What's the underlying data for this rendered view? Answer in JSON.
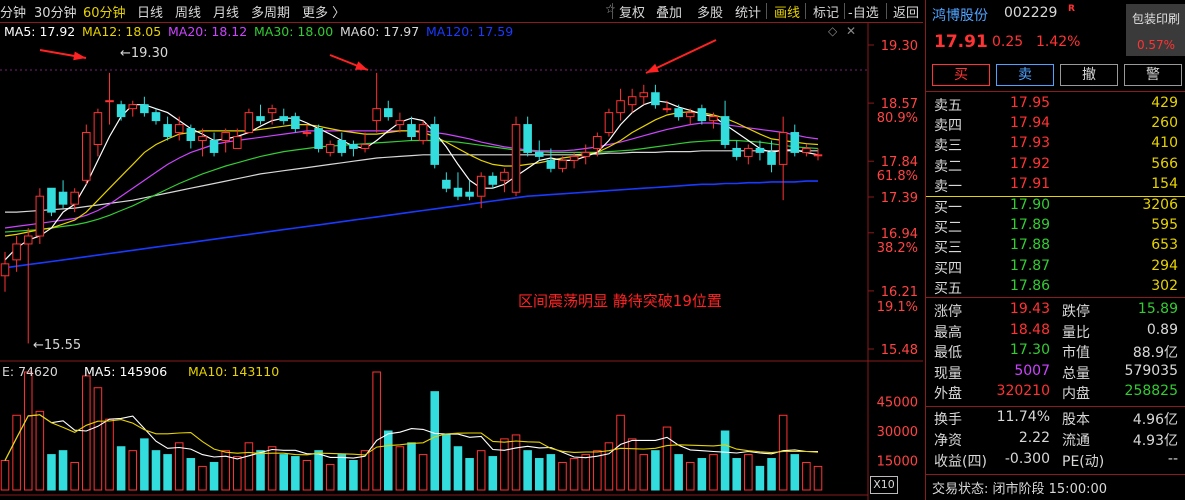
{
  "toolbar": {
    "periods": [
      "分钟",
      "30分钟",
      "60分钟",
      "日线",
      "周线",
      "月线",
      "多周期",
      "更多 〉"
    ],
    "active_period": "60分钟",
    "right_buttons": [
      "复权",
      "叠加",
      "多股",
      "统计",
      "画线",
      "标记",
      "-自选",
      "返回"
    ]
  },
  "ma_legend": {
    "ma5": "MA5: 17.92",
    "ma12": "MA12: 18.05",
    "ma20": "MA20: 18.12",
    "ma30": "MA30: 18.00",
    "ma60": "MA60: 17.97",
    "ma120": "MA120: 17.59"
  },
  "annotations": {
    "high_label": "19.30",
    "low_label": "15.55",
    "note": "区间震荡明显  静待突破19位置"
  },
  "volume_legend": {
    "vol": "E: 74620",
    "ma5": "MA5: 145906",
    "ma10": "MA10: 143110"
  },
  "zoom_label": "X10",
  "colors": {
    "up": "#ff3333",
    "down": "#33dddd",
    "ma5": "#ffffff",
    "ma12": "#e6d200",
    "ma20": "#cc44ff",
    "ma30": "#33cc33",
    "ma60": "#d8d8d8",
    "ma120": "#1a3aff"
  },
  "chart_data": {
    "type": "candlestick",
    "price_axis": {
      "ticks": [
        "19.30",
        "18.57",
        "17.84",
        "17.39",
        "16.94",
        "16.21",
        "15.48"
      ],
      "pct_ticks": [
        "80.9%",
        "61.8%",
        "38.2%",
        "19.1%"
      ]
    },
    "volume_axis": {
      "ticks": [
        "45000",
        "30000",
        "15000"
      ]
    },
    "candles": [
      [
        16.4,
        16.7,
        16.2,
        16.55
      ],
      [
        16.6,
        16.9,
        16.45,
        16.8
      ],
      [
        16.8,
        17.0,
        15.55,
        16.9
      ],
      [
        16.9,
        17.5,
        16.8,
        17.4
      ],
      [
        17.5,
        17.5,
        17.15,
        17.2
      ],
      [
        17.45,
        17.6,
        17.25,
        17.3
      ],
      [
        17.3,
        17.5,
        17.2,
        17.45
      ],
      [
        17.6,
        18.3,
        17.55,
        18.2
      ],
      [
        18.05,
        18.5,
        17.9,
        18.45
      ],
      [
        18.6,
        18.95,
        18.3,
        18.6
      ],
      [
        18.55,
        18.6,
        18.35,
        18.4
      ],
      [
        18.5,
        18.6,
        18.4,
        18.55
      ],
      [
        18.55,
        18.65,
        18.4,
        18.45
      ],
      [
        18.45,
        18.5,
        18.3,
        18.35
      ],
      [
        18.3,
        18.4,
        18.1,
        18.15
      ],
      [
        18.2,
        18.4,
        18.1,
        18.3
      ],
      [
        18.25,
        18.3,
        18.0,
        18.1
      ],
      [
        18.1,
        18.25,
        17.9,
        18.15
      ],
      [
        18.1,
        18.2,
        17.9,
        17.95
      ],
      [
        18.1,
        18.25,
        17.95,
        18.2
      ],
      [
        18.0,
        18.25,
        18.0,
        18.15
      ],
      [
        18.2,
        18.5,
        18.2,
        18.45
      ],
      [
        18.4,
        18.55,
        18.3,
        18.35
      ],
      [
        18.45,
        18.55,
        18.3,
        18.5
      ],
      [
        18.4,
        18.5,
        18.3,
        18.35
      ],
      [
        18.4,
        18.45,
        18.2,
        18.25
      ],
      [
        18.2,
        18.3,
        18.15,
        18.2
      ],
      [
        18.25,
        18.3,
        17.95,
        18.0
      ],
      [
        17.95,
        18.1,
        17.9,
        18.05
      ],
      [
        18.1,
        18.2,
        17.9,
        17.95
      ],
      [
        18.05,
        18.1,
        17.9,
        18.0
      ],
      [
        18.0,
        18.2,
        17.95,
        18.05
      ],
      [
        18.35,
        18.95,
        18.2,
        18.5
      ],
      [
        18.5,
        18.6,
        18.35,
        18.4
      ],
      [
        18.3,
        18.45,
        18.2,
        18.35
      ],
      [
        18.3,
        18.4,
        18.1,
        18.15
      ],
      [
        18.1,
        18.35,
        18.05,
        18.3
      ],
      [
        18.3,
        18.4,
        17.75,
        17.8
      ],
      [
        17.6,
        17.7,
        17.45,
        17.5
      ],
      [
        17.5,
        17.7,
        17.35,
        17.4
      ],
      [
        17.45,
        17.6,
        17.35,
        17.4
      ],
      [
        17.4,
        17.7,
        17.25,
        17.65
      ],
      [
        17.65,
        17.7,
        17.5,
        17.55
      ],
      [
        17.6,
        17.75,
        17.45,
        17.7
      ],
      [
        17.45,
        18.4,
        17.4,
        18.3
      ],
      [
        18.3,
        18.4,
        17.9,
        17.95
      ],
      [
        17.95,
        18.1,
        17.85,
        17.9
      ],
      [
        17.85,
        18.0,
        17.7,
        17.75
      ],
      [
        17.75,
        17.9,
        17.7,
        17.85
      ],
      [
        17.85,
        17.95,
        17.75,
        17.9
      ],
      [
        17.9,
        18.05,
        17.8,
        17.95
      ],
      [
        18.0,
        18.2,
        17.9,
        18.15
      ],
      [
        18.2,
        18.5,
        18.15,
        18.45
      ],
      [
        18.45,
        18.75,
        18.35,
        18.6
      ],
      [
        18.55,
        18.75,
        18.45,
        18.65
      ],
      [
        18.65,
        18.8,
        18.55,
        18.7
      ],
      [
        18.7,
        18.8,
        18.5,
        18.55
      ],
      [
        18.5,
        18.6,
        18.45,
        18.5
      ],
      [
        18.5,
        18.55,
        18.35,
        18.4
      ],
      [
        18.4,
        18.5,
        18.3,
        18.45
      ],
      [
        18.5,
        18.55,
        18.3,
        18.35
      ],
      [
        18.35,
        18.45,
        18.25,
        18.4
      ],
      [
        18.4,
        18.6,
        18.0,
        18.05
      ],
      [
        18.0,
        18.1,
        17.85,
        17.9
      ],
      [
        17.9,
        18.05,
        17.8,
        18.0
      ],
      [
        18.0,
        18.1,
        17.85,
        17.95
      ],
      [
        17.95,
        18.1,
        17.7,
        17.8
      ],
      [
        17.8,
        18.4,
        17.35,
        18.2
      ],
      [
        18.2,
        18.3,
        17.9,
        17.95
      ],
      [
        17.95,
        18.05,
        17.9,
        18.0
      ],
      [
        17.92,
        18.0,
        17.85,
        17.92
      ]
    ],
    "volumes": [
      15000,
      38000,
      60000,
      40000,
      18000,
      20000,
      14000,
      58000,
      52000,
      36000,
      22000,
      20000,
      26000,
      20000,
      18000,
      24000,
      16000,
      12000,
      14000,
      20000,
      17000,
      24000,
      20000,
      22000,
      18000,
      17000,
      15000,
      20000,
      13000,
      18000,
      15000,
      20000,
      60000,
      30000,
      22000,
      24000,
      18000,
      50000,
      28000,
      22000,
      16000,
      20000,
      17000,
      26000,
      28000,
      20000,
      16000,
      18000,
      14000,
      16000,
      18000,
      20000,
      24000,
      38000,
      26000,
      18000,
      20000,
      32000,
      18000,
      14000,
      16000,
      18000,
      30000,
      16000,
      18000,
      12000,
      16000,
      38000,
      18000,
      14000,
      12000
    ],
    "ma_lines": {
      "ma5": [
        16.6,
        16.75,
        16.85,
        16.9,
        17.0,
        17.2,
        17.3,
        17.55,
        17.85,
        18.15,
        18.4,
        18.55,
        18.55,
        18.5,
        18.45,
        18.35,
        18.25,
        18.18,
        18.1,
        18.12,
        18.15,
        18.2,
        18.28,
        18.35,
        18.38,
        18.38,
        18.32,
        18.25,
        18.18,
        18.1,
        18.03,
        18.0,
        18.1,
        18.22,
        18.33,
        18.38,
        18.35,
        18.2,
        18.02,
        17.8,
        17.6,
        17.5,
        17.5,
        17.55,
        17.65,
        17.75,
        17.85,
        17.88,
        17.85,
        17.85,
        17.9,
        17.95,
        18.1,
        18.3,
        18.45,
        18.55,
        18.6,
        18.58,
        18.52,
        18.48,
        18.43,
        18.4,
        18.3,
        18.2,
        18.1,
        18.0,
        17.95,
        17.98,
        17.98,
        17.95,
        17.92
      ],
      "ma12": [
        16.9,
        16.92,
        16.95,
        16.98,
        17.0,
        17.05,
        17.1,
        17.2,
        17.35,
        17.5,
        17.65,
        17.8,
        17.95,
        18.05,
        18.12,
        18.18,
        18.2,
        18.22,
        18.22,
        18.22,
        18.22,
        18.22,
        18.24,
        18.26,
        18.28,
        18.3,
        18.3,
        18.28,
        18.25,
        18.22,
        18.2,
        18.18,
        18.18,
        18.2,
        18.22,
        18.22,
        18.2,
        18.15,
        18.08,
        18.0,
        17.92,
        17.85,
        17.8,
        17.78,
        17.78,
        17.8,
        17.82,
        17.85,
        17.88,
        17.9,
        17.92,
        17.95,
        18.02,
        18.1,
        18.2,
        18.28,
        18.36,
        18.42,
        18.45,
        18.46,
        18.45,
        18.42,
        18.38,
        18.32,
        18.25,
        18.18,
        18.12,
        18.1,
        18.08,
        18.06,
        18.05
      ],
      "ma20": [
        17.0,
        17.02,
        17.04,
        17.06,
        17.08,
        17.1,
        17.12,
        17.16,
        17.22,
        17.3,
        17.4,
        17.5,
        17.6,
        17.7,
        17.8,
        17.88,
        17.95,
        18.0,
        18.05,
        18.08,
        18.1,
        18.12,
        18.14,
        18.16,
        18.18,
        18.2,
        18.22,
        18.22,
        18.22,
        18.22,
        18.22,
        18.22,
        18.22,
        18.22,
        18.22,
        18.22,
        18.22,
        18.2,
        18.18,
        18.15,
        18.12,
        18.08,
        18.05,
        18.02,
        18.0,
        17.98,
        17.97,
        17.97,
        17.97,
        17.98,
        18.0,
        18.02,
        18.05,
        18.08,
        18.12,
        18.16,
        18.2,
        18.24,
        18.27,
        18.3,
        18.32,
        18.32,
        18.3,
        18.28,
        18.26,
        18.24,
        18.22,
        18.2,
        18.17,
        18.14,
        18.12
      ],
      "ma30": [
        16.95,
        16.96,
        16.97,
        16.98,
        17.0,
        17.02,
        17.04,
        17.07,
        17.11,
        17.16,
        17.22,
        17.28,
        17.35,
        17.42,
        17.49,
        17.56,
        17.62,
        17.68,
        17.73,
        17.78,
        17.82,
        17.86,
        17.9,
        17.93,
        17.96,
        17.98,
        18.0,
        18.02,
        18.03,
        18.04,
        18.05,
        18.06,
        18.07,
        18.08,
        18.09,
        18.1,
        18.1,
        18.1,
        18.09,
        18.08,
        18.06,
        18.04,
        18.02,
        18.0,
        17.98,
        17.97,
        17.96,
        17.95,
        17.95,
        17.95,
        17.95,
        17.95,
        17.96,
        17.97,
        17.98,
        18.0,
        18.02,
        18.04,
        18.06,
        18.08,
        18.09,
        18.1,
        18.1,
        18.1,
        18.09,
        18.08,
        18.06,
        18.04,
        18.02,
        18.01,
        18.0
      ],
      "ma60": [
        17.2,
        17.2,
        17.21,
        17.22,
        17.23,
        17.24,
        17.25,
        17.27,
        17.29,
        17.31,
        17.33,
        17.35,
        17.38,
        17.41,
        17.44,
        17.47,
        17.5,
        17.53,
        17.56,
        17.59,
        17.62,
        17.65,
        17.68,
        17.7,
        17.72,
        17.74,
        17.76,
        17.78,
        17.8,
        17.82,
        17.84,
        17.86,
        17.88,
        17.89,
        17.9,
        17.91,
        17.92,
        17.92,
        17.92,
        17.92,
        17.92,
        17.92,
        17.92,
        17.92,
        17.92,
        17.92,
        17.92,
        17.92,
        17.92,
        17.92,
        17.93,
        17.93,
        17.94,
        17.94,
        17.95,
        17.95,
        17.95,
        17.96,
        17.96,
        17.96,
        17.97,
        17.97,
        17.97,
        17.97,
        17.97,
        17.97,
        17.97,
        17.97,
        17.97,
        17.97,
        17.97
      ],
      "ma120": [
        16.5,
        16.52,
        16.54,
        16.56,
        16.58,
        16.6,
        16.62,
        16.64,
        16.66,
        16.68,
        16.7,
        16.72,
        16.74,
        16.76,
        16.78,
        16.8,
        16.82,
        16.84,
        16.86,
        16.88,
        16.9,
        16.92,
        16.94,
        16.96,
        16.98,
        17.0,
        17.02,
        17.04,
        17.06,
        17.08,
        17.1,
        17.12,
        17.14,
        17.16,
        17.18,
        17.2,
        17.22,
        17.24,
        17.26,
        17.28,
        17.3,
        17.32,
        17.34,
        17.36,
        17.38,
        17.4,
        17.41,
        17.42,
        17.43,
        17.44,
        17.45,
        17.46,
        17.47,
        17.48,
        17.49,
        17.5,
        17.51,
        17.52,
        17.53,
        17.54,
        17.55,
        17.55,
        17.56,
        17.56,
        17.57,
        17.57,
        17.58,
        17.58,
        17.58,
        17.59,
        17.59
      ]
    }
  },
  "panel": {
    "stock_name": "鸿博股份",
    "stock_code": "002229",
    "r_badge": "R",
    "badge_title": "包装印刷",
    "badge_value": "0.57%",
    "price": "17.91",
    "change": "0.25",
    "change_pct": "1.42%",
    "buttons": [
      "买",
      "卖",
      "撤",
      "警"
    ],
    "asks": [
      {
        "label": "卖五",
        "price": "17.95",
        "vol": "429"
      },
      {
        "label": "卖四",
        "price": "17.94",
        "vol": "260"
      },
      {
        "label": "卖三",
        "price": "17.93",
        "vol": "410"
      },
      {
        "label": "卖二",
        "price": "17.92",
        "vol": "566"
      },
      {
        "label": "卖一",
        "price": "17.91",
        "vol": "154"
      }
    ],
    "bids": [
      {
        "label": "买一",
        "price": "17.90",
        "vol": "3206"
      },
      {
        "label": "买二",
        "price": "17.89",
        "vol": "595"
      },
      {
        "label": "买三",
        "price": "17.88",
        "vol": "653"
      },
      {
        "label": "买四",
        "price": "17.87",
        "vol": "294"
      },
      {
        "label": "买五",
        "price": "17.86",
        "vol": "302"
      }
    ],
    "stats1": [
      {
        "l1": "涨停",
        "v1": "19.43",
        "l2": "跌停",
        "v2": "15.89"
      },
      {
        "l1": "最高",
        "v1": "18.48",
        "l2": "量比",
        "v2": "0.89"
      },
      {
        "l1": "最低",
        "v1": "17.30",
        "l2": "市值",
        "v2": "88.9亿"
      },
      {
        "l1": "现量",
        "v1": "5007",
        "l2": "总量",
        "v2": "579035"
      },
      {
        "l1": "外盘",
        "v1": "320210",
        "l2": "内盘",
        "v2": "258825"
      }
    ],
    "stats2": [
      {
        "l1": "换手",
        "v1": "11.74%",
        "l2": "股本",
        "v2": "4.96亿"
      },
      {
        "l1": "净资",
        "v1": "2.22",
        "l2": "流通",
        "v2": "4.93亿"
      },
      {
        "l1": "收益(四)",
        "v1": "-0.300",
        "l2": "PE(动)",
        "v2": "--"
      }
    ],
    "status": "交易状态: 闭市阶段 15:00:00"
  }
}
